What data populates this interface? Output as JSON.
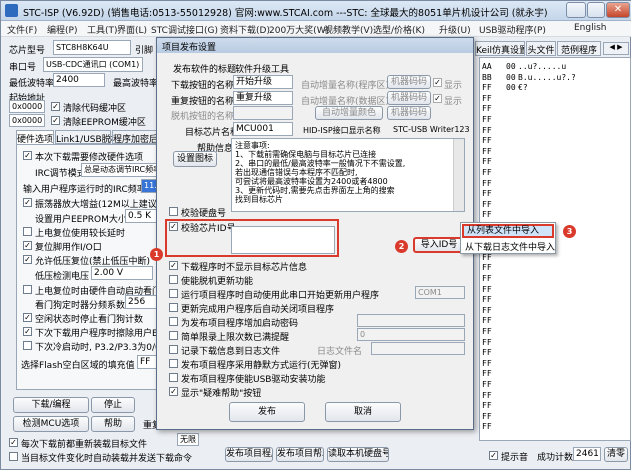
{
  "main": {
    "title": "STC-ISP (V6.92D) (销售电话:0513-55012928) 官网:www.STCAI.com  ---STC: 全球最大的8051单片机设计公司 (就永宇)",
    "menu": [
      "文件(F)",
      "编程(P)",
      "工具(T)",
      "界面(L)",
      "STC调试接口(G)",
      "资料下载(D)",
      "200万大奖(W)",
      "视频教学(V)",
      "选型/价格(K)",
      "升级(U)",
      "USB驱动程序(P)",
      "English"
    ],
    "chip_label": "芯片型号",
    "chip_value": "STC8H8K64U",
    "pin_label": "引脚",
    "pin_value": "Auto",
    "port_label": "串口号",
    "port_value": "USB-CDC通讯口 (COM1)",
    "scan_btn": "扫描",
    "minbaud_label": "最低波特率",
    "minbaud_value": "2400",
    "maxbaud_label": "最高波特率",
    "start_addr_label": "起始地址",
    "addr1": "0x0000",
    "clear_code": "清除代码缓冲区",
    "addr2": "0x0000",
    "clear_eeprom": "清除EEPROM缓冲区",
    "hw_tabs": [
      "硬件选项",
      "Link1/USB脱机",
      "程序加密后"
    ],
    "hw_opts": [
      "本次下载需要修改硬件选项",
      "IRC调节模式",
      "输入用户程序运行时的IRC频率",
      "振荡器放大增益(12M以上建议选择)",
      "设置用户EEPROM大小",
      "上电复位使用较长延时",
      "复位脚用作I/O口",
      "允许低压复位(禁止低压中断)",
      "低压检测电压",
      "上电复位时由硬件自动启动看门狗",
      "看门狗定时器分频系数",
      "空闲状态时停止看门狗计数",
      "下次下载用户程序时擦除用户EEPROM区",
      "下次冷启动时, P3.2/P3.3为0/0才可下载程序",
      "选择Flash空白区域的填充值"
    ],
    "irc_value": "总是动态调节IRC频率",
    "irc_freq": "11.059",
    "eeprom_size": "0.5 K",
    "lvd_value": "2.00 V",
    "wdt_div": "256",
    "fill_value": "FF",
    "download_btn": "下载/编程",
    "stop_btn": "停止",
    "detect_btn": "检测MCU选项",
    "help_btn": "帮助",
    "retry_label": "重复",
    "retry_value": "无限",
    "bottom_check1": "每次下载前都重新装载目标文件",
    "bottom_check2": "当目标文件变化时自动装载并发送下载命令",
    "bottom_btns": [
      "发布项目程序",
      "发布项目帮助",
      "读取本机硬盘号"
    ],
    "tip_label": "提示音",
    "success_label": "成功计数",
    "success_value": "2461",
    "clear_btn": "清零",
    "right_tabs": [
      "程序文件",
      "EEPROM文件",
      "串口助手",
      "Keil仿真设置",
      "头文件",
      "范例程序"
    ],
    "hex_rows": [
      [
        "AA",
        "00",
        "..u?.....u"
      ],
      [
        "BB",
        "00",
        "B.u.....u?.?"
      ],
      [
        "FF",
        "00",
        "€?"
      ],
      [
        "FF",
        "",
        ""
      ],
      [
        "FF",
        "",
        ""
      ],
      [
        "FF",
        "",
        ""
      ],
      [
        "FF",
        "",
        ""
      ],
      [
        "FF",
        "",
        ""
      ],
      [
        "FF",
        "",
        ""
      ],
      [
        "FF",
        "",
        ""
      ],
      [
        "FF",
        "",
        ""
      ],
      [
        "FF",
        "",
        ""
      ],
      [
        "FF",
        "",
        ""
      ],
      [
        "FF",
        "",
        ""
      ],
      [
        "FF",
        "",
        ""
      ],
      [
        "FF",
        "",
        ""
      ],
      [
        "FF",
        "",
        ""
      ],
      [
        "FF",
        "",
        ""
      ],
      [
        "FF",
        "",
        ""
      ],
      [
        "FF",
        "",
        ""
      ],
      [
        "FF",
        "",
        ""
      ],
      [
        "FF",
        "",
        ""
      ],
      [
        "FF",
        "",
        ""
      ],
      [
        "FF",
        "",
        ""
      ],
      [
        "FF",
        "",
        ""
      ],
      [
        "FF",
        "",
        ""
      ],
      [
        "FF",
        "",
        ""
      ],
      [
        "FF",
        "",
        ""
      ],
      [
        "FF",
        "",
        ""
      ],
      [
        "FF",
        "",
        ""
      ],
      [
        "FF",
        "",
        ""
      ],
      [
        "FF",
        "",
        ""
      ],
      [
        "FF",
        "",
        ""
      ],
      [
        "FF",
        "",
        ""
      ],
      [
        "FF",
        "",
        ""
      ]
    ]
  },
  "dialog": {
    "title": "项目发布设置",
    "section1_label": "发布软件的标题",
    "section1_value": "软件升级工具",
    "row_labels": [
      "下载按钮的名称",
      "重复按钮的名称",
      "脱机按钮的名称"
    ],
    "row_values": [
      "开始升级",
      "重复升级",
      ""
    ],
    "auto_labels": [
      "自动增量名称(程序区)",
      "自动增量名称(数据区)",
      "自动增量颜色"
    ],
    "machine_btn": "机器码码",
    "display": "显示",
    "target_chip_label": "目标芯片名称",
    "target_chip_value": "MCU001",
    "usb_label": "HID-ISP接口显示名称",
    "usb_value": "STC-USB Writer123",
    "help_label": "帮助信息",
    "note_title": "注意事项:",
    "notes": [
      "1、下载前需确保电脑与目标芯片已连接",
      "2、串口的最低/最高波特率一般情况下不需设置,",
      "若出现通信错误与本程序不匹配时,",
      "可尝试将最高波特率设置为2400或者4800",
      "3、更新代码时,需要先点击界面左上角的搜索",
      "找到目标芯片"
    ],
    "set_icon_btn": "设置图标",
    "verify_hd": "校验硬盘号",
    "verify_id": "校验芯片ID号",
    "import_btn": "导入ID号",
    "checks": [
      "下载程序时不显示目标芯片信息",
      "使能脱机更新功能",
      "运行项目程序时自动使用此串口开始更新用户程序",
      "更新完成用户程序后自动关闭项目程序",
      "为发布项目程序增加启动密码",
      "简单限录上限次数已满提醒",
      "记录下载信息到日志文件",
      "发布项目程序采用静默方式运行(无弹窗)",
      "发布项目程序使能USB驱动安装功能",
      "显示\"疑难帮助\"按钮"
    ],
    "com_value": "COM1",
    "limit_value": "0",
    "log_label": "日志文件名",
    "publish_btn": "发布",
    "cancel_btn": "取消"
  },
  "context_menu": {
    "items": [
      "从列表文件中导入",
      "从下载日志文件中导入"
    ]
  },
  "badges": [
    "1",
    "2",
    "3"
  ],
  "colors": {
    "badge": "#d93a2b",
    "title_bar": "#c5d6ea",
    "selected": "#cfe3f9"
  }
}
